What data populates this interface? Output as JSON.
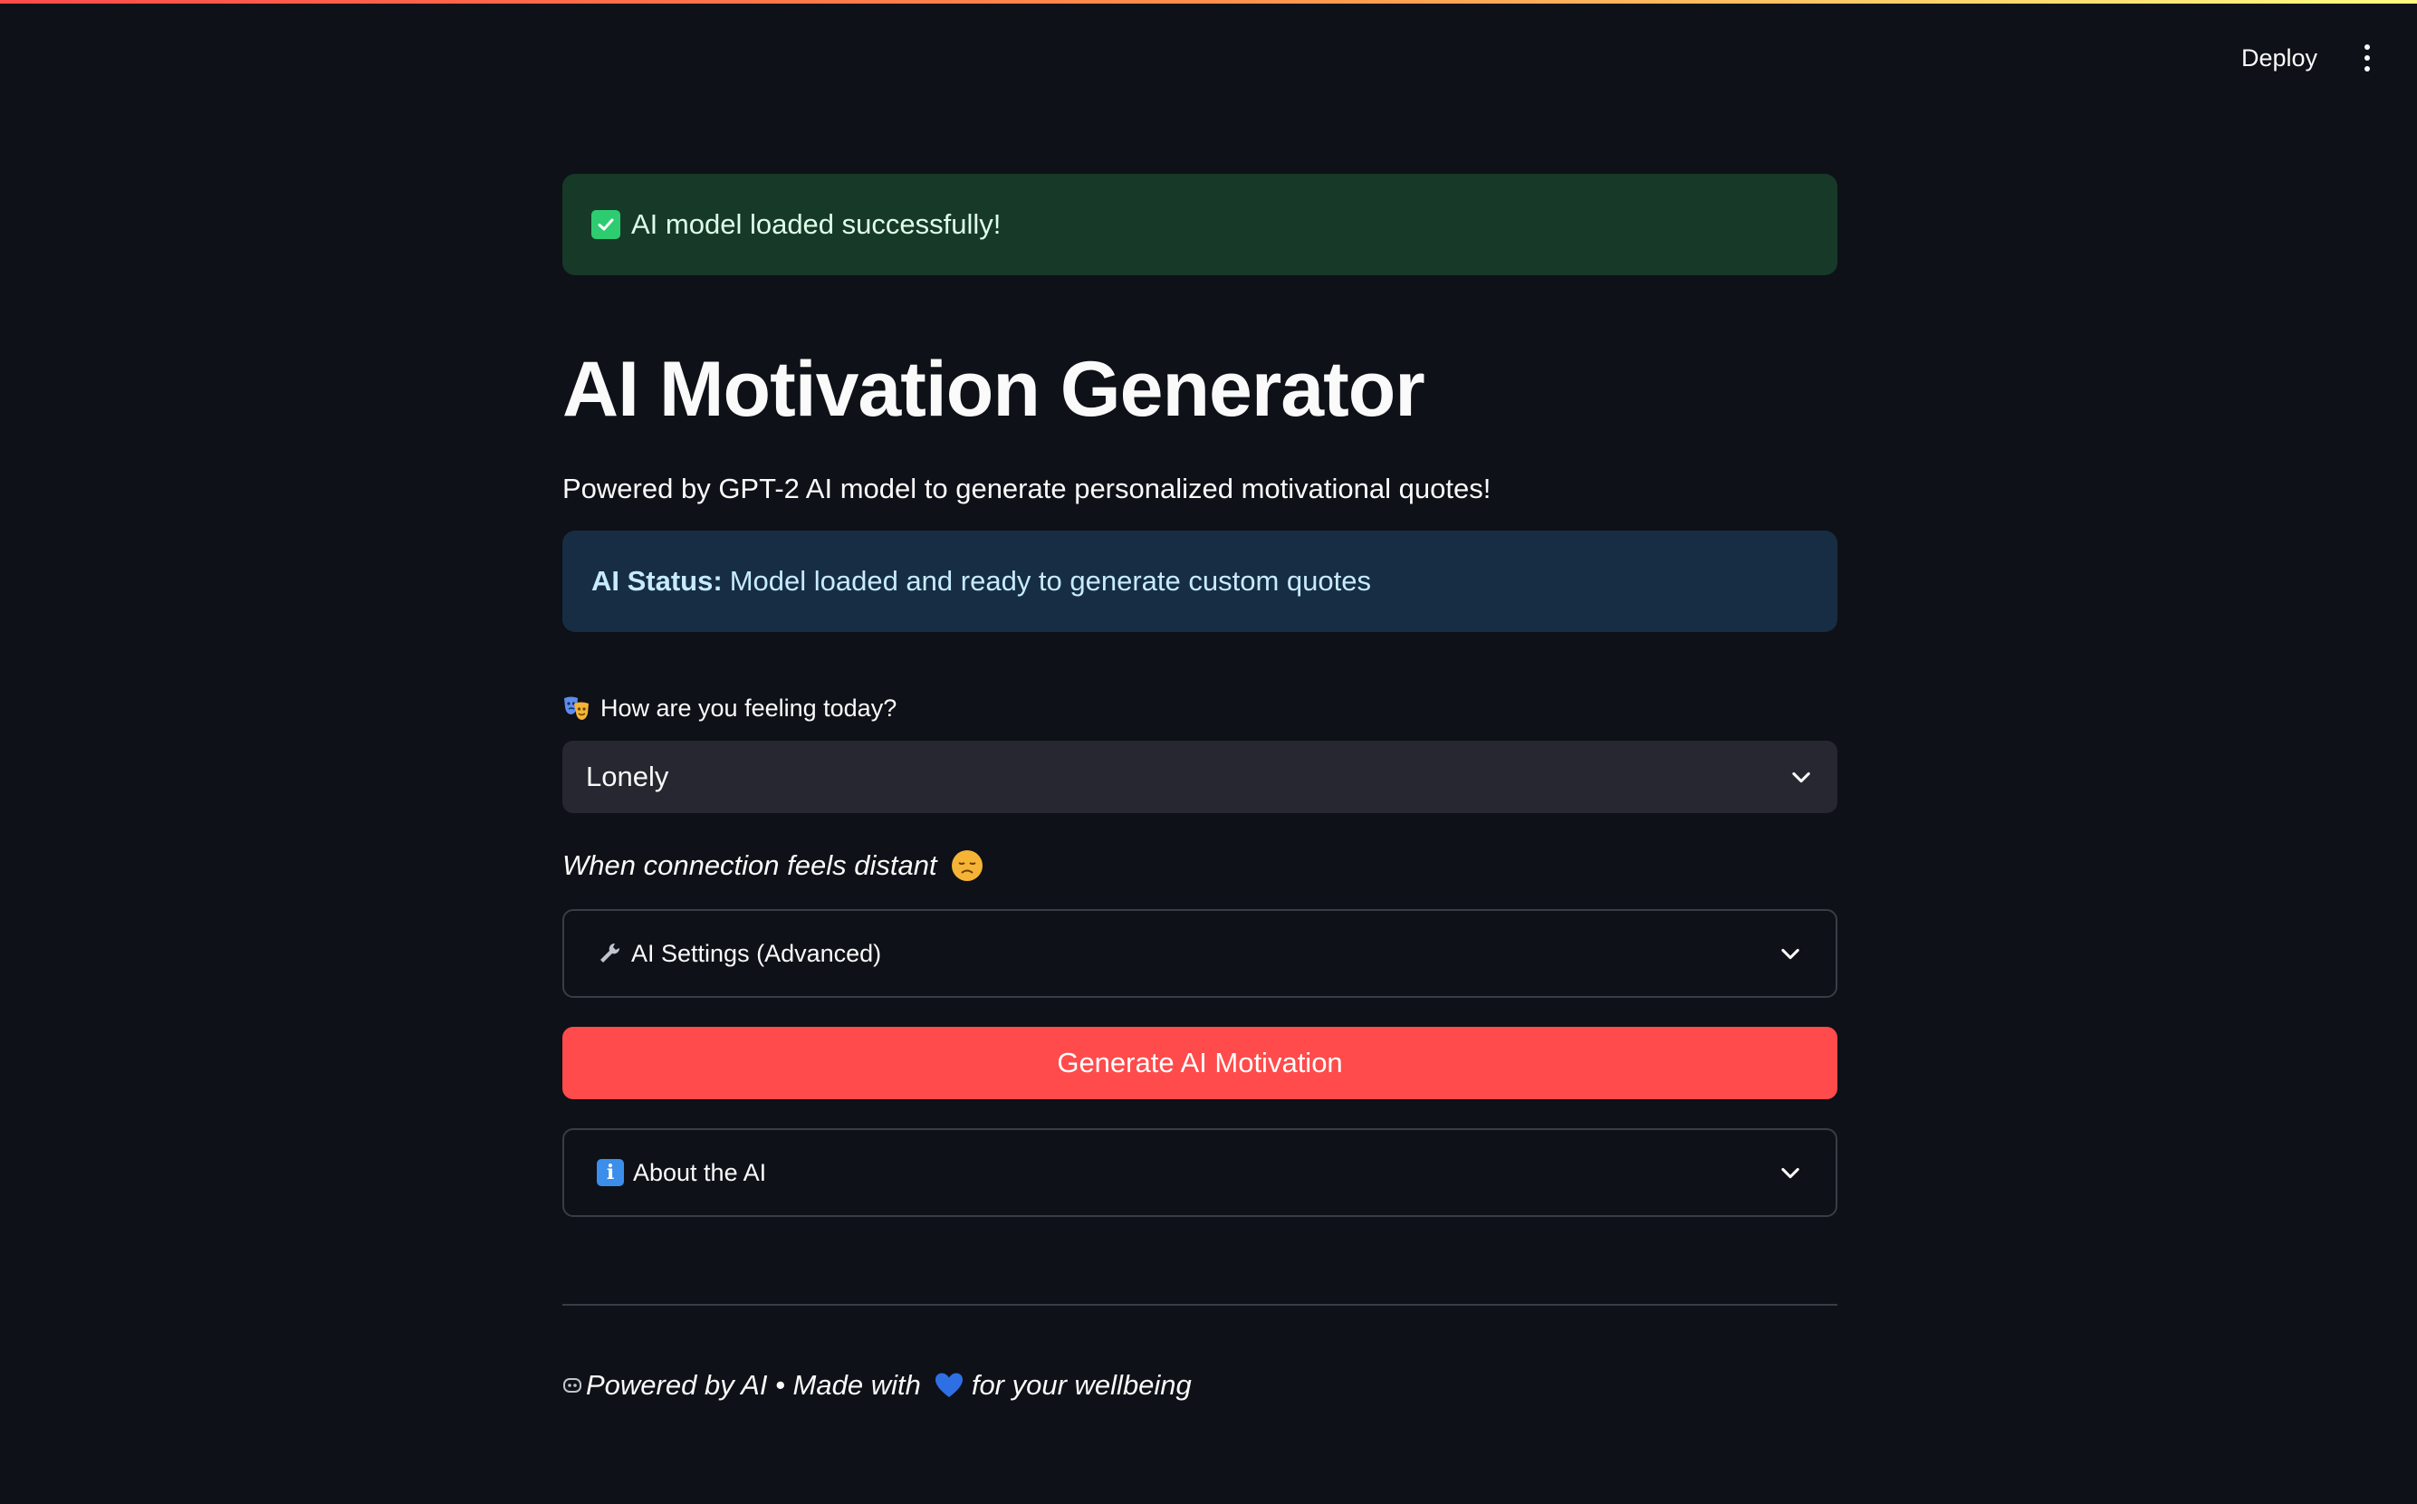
{
  "header": {
    "deploy_label": "Deploy",
    "menu_icon": "more-vertical-icon"
  },
  "alerts": {
    "success_text": "AI model loaded successfully!",
    "status_label": "AI Status:",
    "status_text": "Model loaded and ready to generate custom quotes"
  },
  "page": {
    "title": "AI Motivation Generator",
    "subtitle": "Powered by GPT-2 AI model to generate personalized motivational quotes!"
  },
  "mood_select": {
    "label": "How are you feeling today?",
    "selected": "Lonely",
    "caption": "When connection feels distant"
  },
  "settings_expander": {
    "label": "AI Settings (Advanced)"
  },
  "generate_button": {
    "label": "Generate AI Motivation"
  },
  "about_expander": {
    "label": "About the AI"
  },
  "footer": {
    "text_before": "Powered by AI • Made with",
    "text_after": "for your wellbeing"
  },
  "colors": {
    "background": "#0e1117",
    "primary": "#ff4b4b",
    "success_bg": "#173928",
    "info_bg": "#172d43",
    "select_bg": "#262730"
  }
}
